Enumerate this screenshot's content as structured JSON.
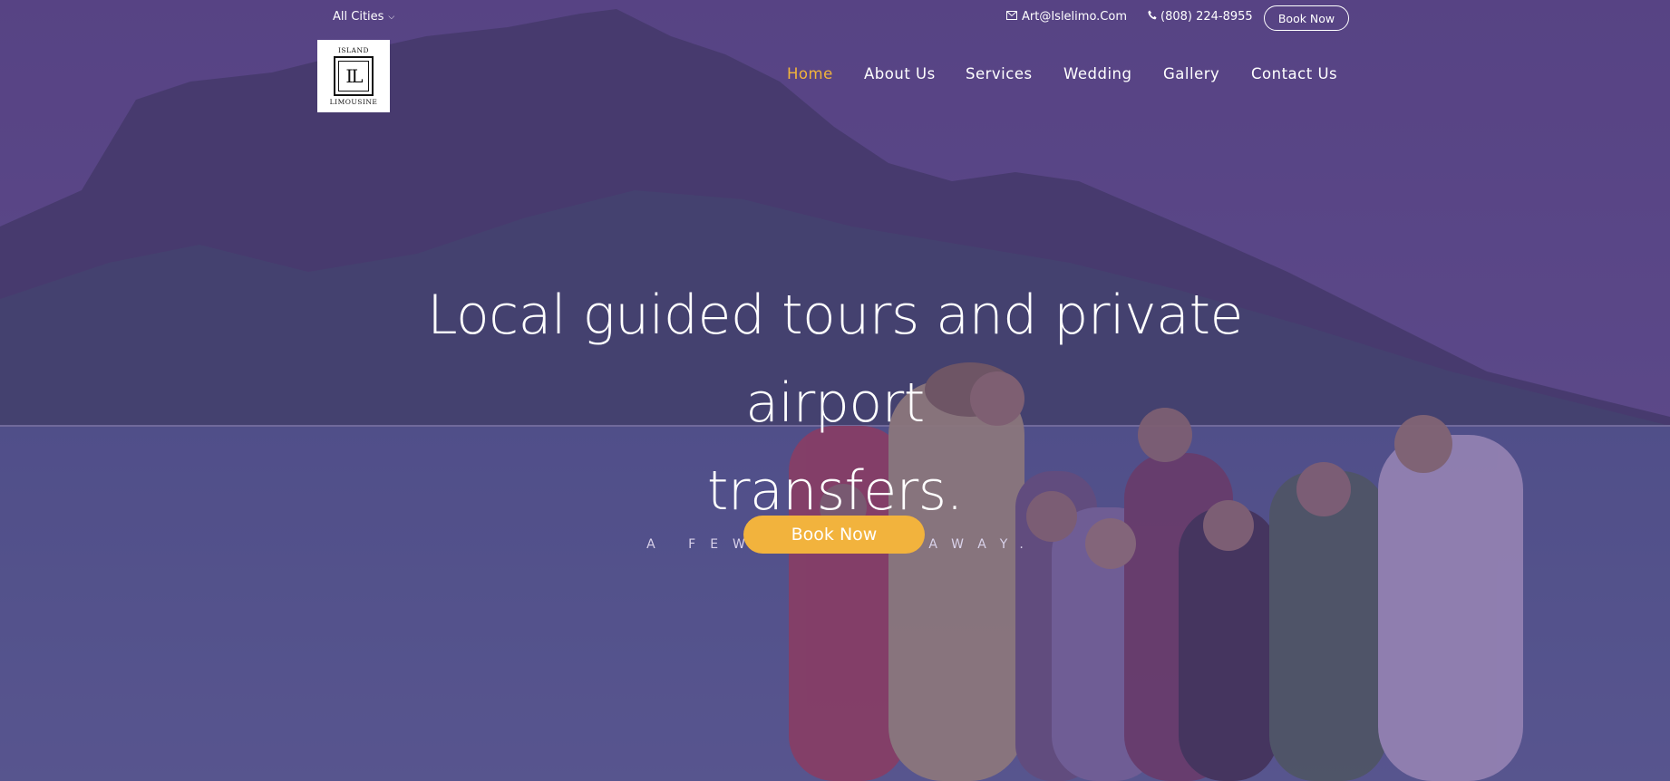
{
  "topbar": {
    "city_select": "All Cities",
    "email": "Art@Islelimo.Com",
    "phone": "(808) 224-8955",
    "book_button": "Book Now"
  },
  "logo": {
    "top_text": "ISLAND",
    "monogram": "IL",
    "bottom_text": "LIMOUSINE"
  },
  "nav": {
    "items": [
      {
        "label": "Home",
        "active": true
      },
      {
        "label": "About Us"
      },
      {
        "label": "Services"
      },
      {
        "label": "Wedding"
      },
      {
        "label": "Gallery"
      },
      {
        "label": "Contact Us"
      }
    ]
  },
  "hero": {
    "title_line1": "Local guided tours and private airport",
    "title_line2": "transfers.",
    "subtitle": "A FEW CLICKS AWAY.",
    "book_button": "Book Now"
  },
  "colors": {
    "accent": "#f2b43a",
    "overlay": "#523c82",
    "text": "#ffffff"
  },
  "icons": [
    "chevron-down-icon",
    "mail-icon",
    "phone-icon"
  ]
}
